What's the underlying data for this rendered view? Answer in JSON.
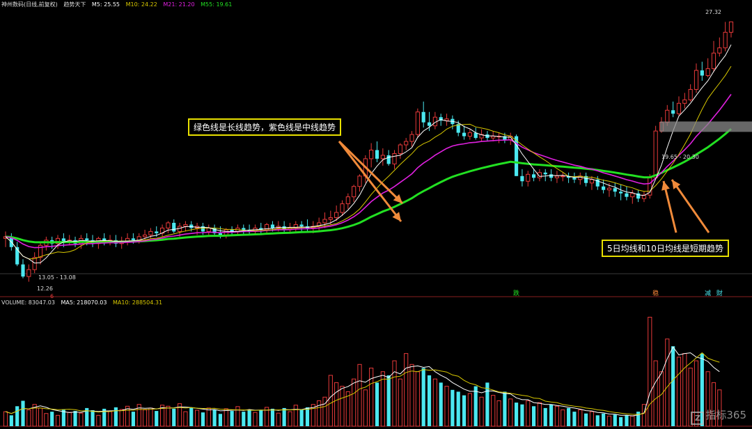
{
  "header": {
    "stock_name": "神州数码(日线,前复权)",
    "indicator_name": "趋势天下",
    "ma5_label": "M5: 25.55",
    "ma10_label": "M10: 24.22",
    "ma21_label": "M21: 21.20",
    "ma55_label": "M55: 19.61"
  },
  "volume_header": {
    "volume_label": "VOLUME: 83047.03",
    "ma5_label": "MA5: 218070.03",
    "ma10_label": "MA10: 288504.31"
  },
  "annotations": {
    "top_note": "绿色线是长线趋势，紫色线是中线趋势",
    "bottom_note": "5日均线和10日均线是短期趋势"
  },
  "price_labels": {
    "high": "27.32",
    "low": "12.26",
    "range_left": "13.05 - 13.08",
    "range_right": "19.65 - 20.30",
    "marker_6": "6"
  },
  "signals": [
    {
      "label": "跌",
      "index": 88
    },
    {
      "label": "稳",
      "index": 112
    },
    {
      "label": "减",
      "index": 121
    },
    {
      "label": "財",
      "index": 123
    }
  ],
  "watermark": "指标365",
  "colors": {
    "up": "#e83a3a",
    "down": "#4be8f0",
    "ma5": "#ffffff",
    "ma10": "#d8c800",
    "ma21": "#e020e0",
    "ma55": "#22e022",
    "note_border": "#e8e000"
  },
  "chart_data": {
    "type": "candlestick",
    "ylim": [
      12.0,
      28.0
    ],
    "opens": [
      14.8,
      14.9,
      14.3,
      13.3,
      12.6,
      13.0,
      13.7,
      14.4,
      14.7,
      14.5,
      14.8,
      14.6,
      14.7,
      14.5,
      14.8,
      14.7,
      14.5,
      14.8,
      14.6,
      14.7,
      14.5,
      14.6,
      14.8,
      14.7,
      14.9,
      15.0,
      15.2,
      15.1,
      15.4,
      15.7,
      15.2,
      15.5,
      15.6,
      15.4,
      15.5,
      15.2,
      15.4,
      15.1,
      15.0,
      15.3,
      15.2,
      15.4,
      15.3,
      15.2,
      15.4,
      15.3,
      15.6,
      15.4,
      15.5,
      15.3,
      15.4,
      15.6,
      15.5,
      15.4,
      15.5,
      15.7,
      15.9,
      16.0,
      16.3,
      16.8,
      17.2,
      17.8,
      18.4,
      19.4,
      19.9,
      19.4,
      19.6,
      19.1,
      19.7,
      20.2,
      20.4,
      20.8,
      22.1,
      21.5,
      21.3,
      21.8,
      21.6,
      21.7,
      21.4,
      20.9,
      20.7,
      20.9,
      20.6,
      20.8,
      20.6,
      20.7,
      20.7,
      20.5,
      20.7,
      18.4,
      18.1,
      18.5,
      18.3,
      18.6,
      18.5,
      18.3,
      18.4,
      18.4,
      18.3,
      18.2,
      18.4,
      18.0,
      18.2,
      17.8,
      17.6,
      17.7,
      17.5,
      17.4,
      17.2,
      17.4,
      17.1,
      17.3,
      18.3,
      21.0,
      21.5,
      22.2,
      22.0,
      22.6,
      22.8,
      23.4,
      24.5,
      24.2,
      24.6,
      25.5,
      25.8,
      26.7
    ],
    "highs": [
      15.2,
      15.1,
      14.6,
      13.6,
      13.3,
      14.0,
      14.6,
      14.9,
      14.9,
      15.0,
      15.1,
      15.0,
      14.9,
      15.0,
      15.1,
      15.0,
      14.9,
      15.1,
      15.0,
      15.0,
      14.9,
      15.1,
      15.1,
      15.1,
      15.3,
      15.4,
      15.5,
      15.6,
      15.8,
      15.9,
      15.7,
      15.8,
      15.8,
      15.7,
      15.7,
      15.6,
      15.6,
      15.5,
      15.4,
      15.5,
      15.6,
      15.6,
      15.6,
      15.6,
      15.7,
      15.7,
      15.8,
      15.8,
      15.8,
      15.7,
      15.8,
      15.8,
      15.9,
      15.8,
      16.0,
      16.3,
      16.4,
      16.7,
      17.0,
      17.4,
      17.9,
      18.5,
      19.6,
      20.3,
      20.4,
      20.0,
      19.9,
      19.9,
      20.3,
      20.6,
      21.0,
      22.3,
      22.7,
      22.1,
      22.1,
      22.0,
      22.0,
      21.9,
      21.6,
      21.3,
      21.1,
      21.2,
      21.1,
      21.0,
      21.0,
      20.9,
      20.9,
      20.9,
      20.8,
      18.8,
      18.7,
      18.8,
      18.8,
      18.8,
      18.8,
      18.7,
      18.6,
      18.6,
      18.6,
      18.6,
      18.6,
      18.4,
      18.4,
      18.2,
      18.0,
      18.0,
      17.9,
      17.8,
      17.6,
      17.6,
      17.5,
      18.5,
      21.3,
      21.8,
      22.5,
      22.7,
      23.0,
      23.2,
      23.7,
      24.9,
      25.0,
      25.2,
      26.2,
      26.4,
      27.3,
      27.3
    ],
    "lows": [
      14.3,
      14.1,
      13.2,
      12.5,
      12.3,
      12.8,
      13.3,
      14.1,
      14.2,
      14.2,
      14.3,
      14.4,
      14.3,
      14.2,
      14.4,
      14.3,
      14.2,
      14.4,
      14.4,
      14.3,
      14.2,
      14.4,
      14.5,
      14.5,
      14.6,
      14.8,
      14.9,
      14.9,
      15.1,
      15.1,
      14.9,
      15.2,
      15.2,
      15.0,
      15.0,
      15.0,
      15.0,
      14.8,
      14.8,
      15.0,
      15.0,
      15.0,
      15.0,
      15.0,
      15.0,
      15.1,
      15.2,
      15.2,
      15.1,
      15.1,
      15.2,
      15.2,
      15.2,
      15.1,
      15.2,
      15.4,
      15.6,
      15.8,
      16.1,
      16.5,
      16.9,
      17.5,
      18.0,
      18.9,
      19.2,
      19.0,
      19.0,
      18.8,
      19.4,
      19.9,
      20.1,
      20.6,
      21.2,
      21.0,
      21.1,
      21.3,
      21.3,
      21.1,
      20.7,
      20.5,
      20.5,
      20.5,
      20.4,
      20.4,
      20.4,
      20.3,
      20.3,
      20.2,
      18.4,
      17.8,
      17.8,
      18.1,
      18.1,
      18.1,
      18.1,
      18.0,
      18.1,
      18.0,
      18.0,
      17.9,
      17.8,
      17.6,
      17.6,
      17.4,
      17.2,
      17.2,
      17.0,
      17.0,
      16.8,
      16.9,
      16.9,
      17.1,
      18.2,
      20.9,
      21.3,
      21.8,
      21.9,
      22.3,
      22.7,
      23.2,
      23.9,
      24.1,
      24.4,
      25.3,
      25.6,
      26.4
    ],
    "closes": [
      14.9,
      14.3,
      13.3,
      12.6,
      13.0,
      13.7,
      14.4,
      14.7,
      14.5,
      14.8,
      14.6,
      14.7,
      14.5,
      14.8,
      14.7,
      14.5,
      14.8,
      14.6,
      14.7,
      14.5,
      14.6,
      14.8,
      14.7,
      14.9,
      15.0,
      15.2,
      15.1,
      15.4,
      15.7,
      15.2,
      15.5,
      15.6,
      15.4,
      15.5,
      15.2,
      15.4,
      15.1,
      15.0,
      15.3,
      15.2,
      15.4,
      15.3,
      15.2,
      15.4,
      15.3,
      15.6,
      15.4,
      15.5,
      15.3,
      15.4,
      15.6,
      15.5,
      15.4,
      15.5,
      15.7,
      15.9,
      16.0,
      16.3,
      16.8,
      17.2,
      17.8,
      18.4,
      19.4,
      19.9,
      19.4,
      19.6,
      19.1,
      19.7,
      20.2,
      20.4,
      20.8,
      22.1,
      21.5,
      21.3,
      21.8,
      21.6,
      21.7,
      21.4,
      20.9,
      20.7,
      20.9,
      20.6,
      20.8,
      20.6,
      20.7,
      20.7,
      20.5,
      20.7,
      18.4,
      18.1,
      18.5,
      18.3,
      18.6,
      18.5,
      18.3,
      18.4,
      18.4,
      18.3,
      18.2,
      18.4,
      18.0,
      18.2,
      17.8,
      17.6,
      17.7,
      17.5,
      17.4,
      17.2,
      17.4,
      17.1,
      17.3,
      18.3,
      21.0,
      21.5,
      22.2,
      22.0,
      22.6,
      22.8,
      23.4,
      24.5,
      24.2,
      24.6,
      25.5,
      25.8,
      26.7,
      27.3
    ],
    "volumes": [
      40,
      30,
      55,
      70,
      45,
      60,
      50,
      35,
      40,
      30,
      45,
      38,
      42,
      36,
      50,
      44,
      30,
      48,
      40,
      52,
      46,
      55,
      40,
      60,
      45,
      50,
      42,
      58,
      55,
      48,
      62,
      40,
      52,
      44,
      38,
      50,
      46,
      34,
      48,
      42,
      54,
      40,
      46,
      38,
      44,
      52,
      48,
      36,
      50,
      40,
      58,
      46,
      52,
      60,
      70,
      80,
      140,
      120,
      110,
      95,
      130,
      170,
      100,
      160,
      120,
      150,
      140,
      180,
      130,
      200,
      170,
      150,
      160,
      140,
      130,
      120,
      110,
      100,
      95,
      85,
      90,
      110,
      80,
      120,
      85,
      70,
      95,
      75,
      65,
      60,
      70,
      55,
      65,
      50,
      60,
      55,
      45,
      50,
      40,
      45,
      35,
      40,
      30,
      35,
      28,
      32,
      25,
      30,
      28,
      40,
      60,
      300,
      180,
      150,
      240,
      220,
      190,
      200,
      160,
      180,
      200,
      150,
      120,
      100
    ],
    "volume_ylim": [
      0,
      320
    ]
  }
}
